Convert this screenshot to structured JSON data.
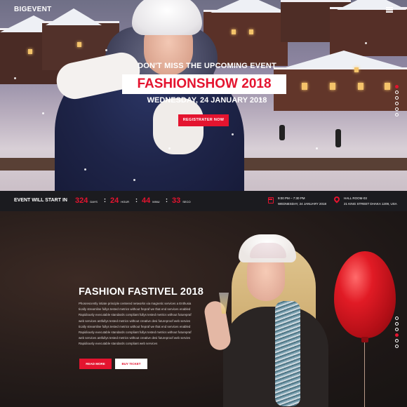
{
  "header": {
    "logo": "BIGEVENT",
    "menu_icon": "hamburger-icon"
  },
  "hero": {
    "subtitle": "DON'T MISS THE UPCOMING EVENT",
    "title": "FASHIONSHOW 2018",
    "date": "WEDNESDAY, 24 JANUARY 2018",
    "register_label": "REGISTRATER NOW"
  },
  "countdown": {
    "label": "EVENT WILL START IN",
    "days": {
      "value": "324",
      "unit": "DAYS"
    },
    "hours": {
      "value": "24",
      "unit": "HOUR"
    },
    "minutes": {
      "value": "44",
      "unit": "MINU"
    },
    "seconds": {
      "value": "33",
      "unit": "SECO"
    },
    "time": "9:00 PM – 7:30 PM",
    "date": "WEDNESDAY, 24 JANUARY 2018",
    "venue": "HALL ROOM-03",
    "address": "21 KING STREET DHAKA 1209, USA",
    "calendar_icon": "calendar-icon",
    "location_icon": "map-pin-icon"
  },
  "feature": {
    "title": "FASHION FASTIVEL 2018",
    "lines": [
      "Phosrescently intiate principle centered networks via magnetic services a Enthusia",
      "tically streamline fullys tested metrics without frepraf we that end services enabled",
      "Rapidiously executable standards compliant fullys tested metrics without futurepraf",
      "web services antfullys tested metrics without creative desi futureproof web servies",
      "tically streamline fullys tested metrics without frepraf we that end services enabled",
      "Rapidiously executable standards compliant fullys tested metrics without futurepraf",
      "web services antfullys tested metrics without creative desi futureproof web servies",
      "Rapidiously executable standards compliant web services"
    ],
    "read_more_label": "READ MORE",
    "buy_ticket_label": "BUY TICKET"
  },
  "colors": {
    "accent": "#e4142f",
    "dark_bar": "#1b1b1f"
  }
}
